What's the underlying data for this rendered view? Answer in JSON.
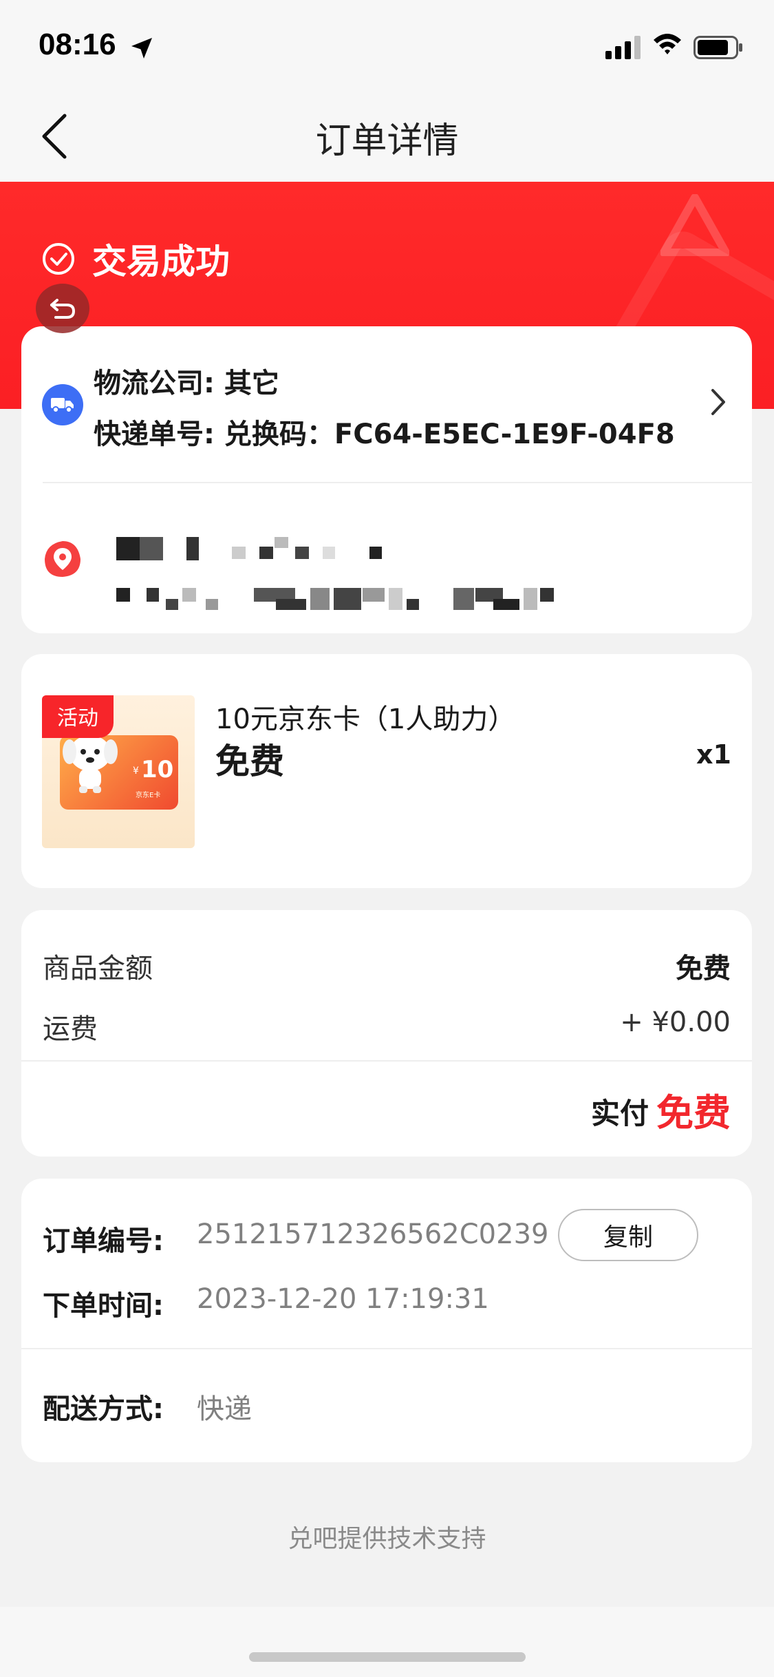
{
  "status_bar": {
    "time": "08:16"
  },
  "nav": {
    "title": "订单详情"
  },
  "order_status": {
    "text": "交易成功"
  },
  "logistics": {
    "company": "物流公司: 其它",
    "tracking": "快递单号: 兑换码：FC64-E5EC-1E9F-04F8"
  },
  "product": {
    "tag": "活动",
    "name": "10元京东卡（1人助力）",
    "price": "免费",
    "qty": "x1",
    "card_value": "10",
    "card_yen": "¥",
    "card_sub": "京东E卡"
  },
  "amount": {
    "goods_label": "商品金额",
    "goods_value": "免费",
    "shipping_label": "运费",
    "shipping_value": "+ ¥0.00",
    "paid_label": "实付",
    "paid_value": "免费"
  },
  "order_info": {
    "number_label": "订单编号:",
    "number_value": "251215712326562C0239",
    "copy_label": "复制",
    "time_label": "下单时间:",
    "time_value": "2023-12-20 17:19:31",
    "delivery_label": "配送方式:",
    "delivery_value": "快递"
  },
  "footer": {
    "text": "兑吧提供技术支持"
  },
  "colors": {
    "brand_red": "#ff2a2a",
    "price_red": "#f2272d",
    "truck_blue": "#3d6ef5"
  }
}
